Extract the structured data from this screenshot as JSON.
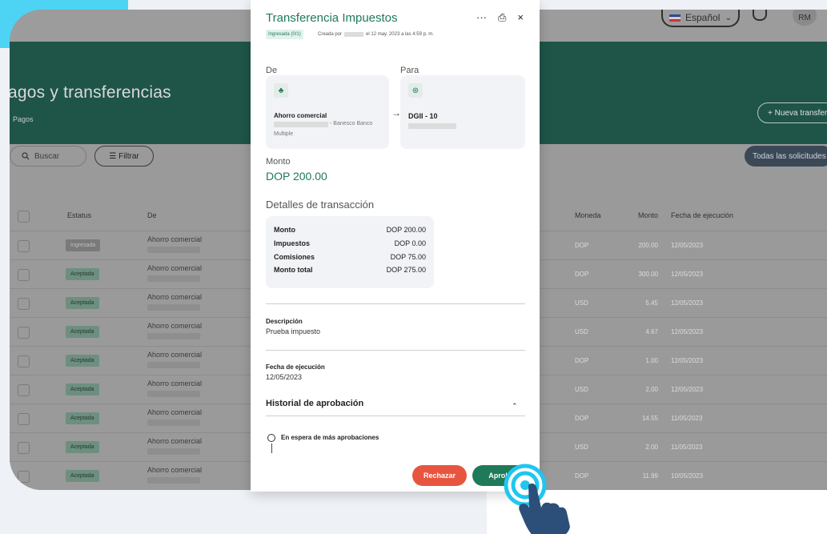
{
  "header": {
    "language": "Español",
    "user_initials": "RM"
  },
  "page": {
    "title": "agos y transferencias",
    "breadcrumb": "Pagos",
    "new_button": "+ Nueva transfer",
    "search_placeholder": "Buscar",
    "filter_label": "Filtrar",
    "all_requests_button": "Todas las solicitudes"
  },
  "table": {
    "columns": {
      "status": "Estatus",
      "de": "De",
      "moneda": "Moneda",
      "monto": "Monto",
      "fecha": "Fecha de ejecución"
    },
    "rows": [
      {
        "status": "Ingresada",
        "de": "Ahorro comercial",
        "moneda": "DOP",
        "monto": "200.00",
        "fecha": "12/05/2023"
      },
      {
        "status": "Aceptada",
        "de": "Ahorro comercial",
        "moneda": "DOP",
        "monto": "300.00",
        "fecha": "12/05/2023"
      },
      {
        "status": "Aceptada",
        "de": "Ahorro comercial",
        "moneda": "USD",
        "monto": "5.45",
        "fecha": "12/05/2023"
      },
      {
        "status": "Aceptada",
        "de": "Ahorro comercial",
        "moneda": "USD",
        "monto": "4.67",
        "fecha": "12/05/2023"
      },
      {
        "status": "Aceptada",
        "de": "Ahorro comercial",
        "moneda": "DOP",
        "monto": "1.00",
        "fecha": "12/05/2023"
      },
      {
        "status": "Aceptada",
        "de": "Ahorro comercial",
        "moneda": "USD",
        "monto": "2.00",
        "fecha": "12/05/2023"
      },
      {
        "status": "Aceptada",
        "de": "Ahorro comercial",
        "moneda": "DOP",
        "monto": "14.55",
        "fecha": "11/05/2023"
      },
      {
        "status": "Aceptada",
        "de": "Ahorro comercial",
        "moneda": "USD",
        "monto": "2.00",
        "fecha": "11/05/2023"
      },
      {
        "status": "Aceptada",
        "de": "Ahorro comercial",
        "moneda": "DOP",
        "monto": "11.99",
        "fecha": "10/05/2023"
      }
    ]
  },
  "modal": {
    "title": "Transferencia Impuestos",
    "tools": {
      "more": "···",
      "print": "⎙",
      "close": "×"
    },
    "tag": "Ingresada (0/1)",
    "meta_created": "Creada por",
    "meta_date": "el 12 may. 2023 a las 4:59 p. m.",
    "from_label": "De",
    "to_label": "Para",
    "from_account": "Ahorro comercial",
    "from_bank": "- Banesco Banco",
    "from_bank_2": "Multiple",
    "to_account": "DGII - 10",
    "amount_label": "Monto",
    "amount_value": "DOP 200.00",
    "details_title": "Detalles de transacción",
    "details": [
      {
        "k": "Monto",
        "v": "DOP 200.00"
      },
      {
        "k": "Impuestos",
        "v": "DOP 0.00"
      },
      {
        "k": "Comisiones",
        "v": "DOP 75.00"
      },
      {
        "k": "Monto total",
        "v": "DOP 275.00"
      }
    ],
    "description_label": "Descripción",
    "description_value": "Prueba impuesto",
    "exec_date_label": "Fecha de ejecución",
    "exec_date_value": "12/05/2023",
    "history_title": "Historial de aprobación",
    "history_status": "En espera de más aprobaciones",
    "reject_button": "Rechazar",
    "approve_button": "Aproba"
  },
  "colors": {
    "brand_green": "#1f7a59",
    "reject_red": "#e8553f",
    "cursor_cyan": "#1fc6f0",
    "hand_navy": "#2b4f78"
  }
}
